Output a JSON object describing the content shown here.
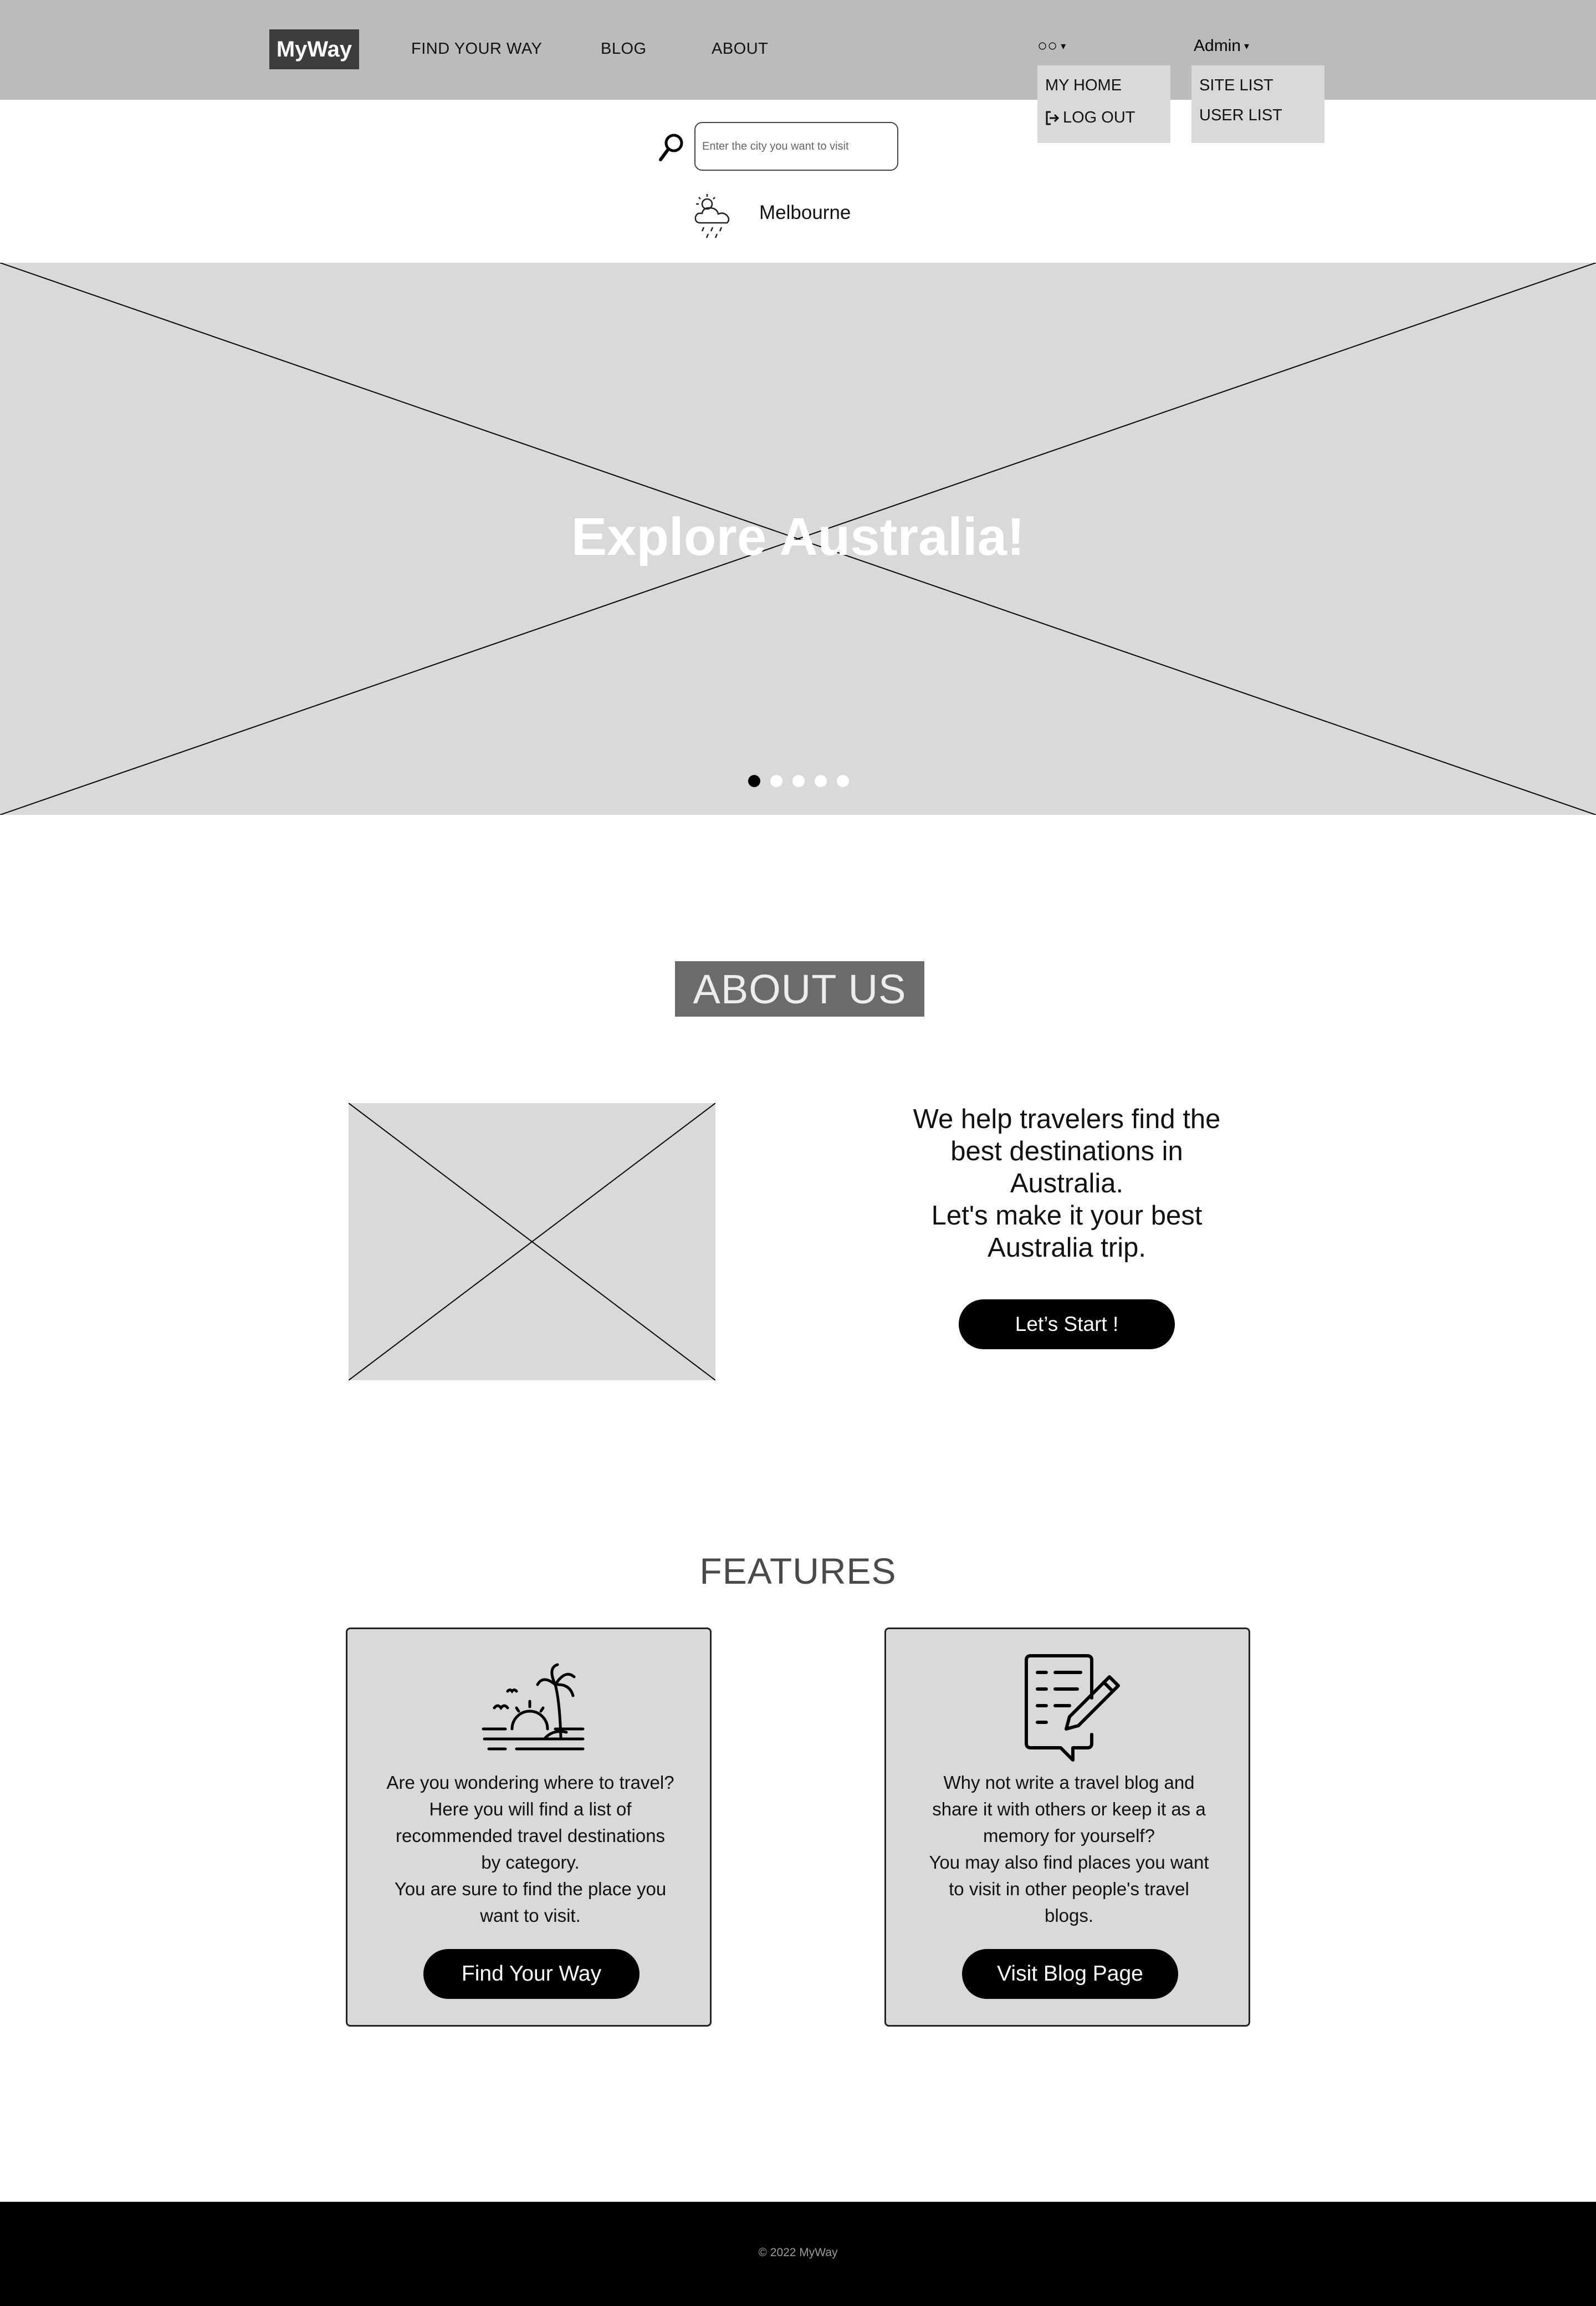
{
  "nav": {
    "logo": "MyWay",
    "links": [
      "FIND YOUR WAY",
      "BLOG",
      "ABOUT"
    ],
    "user_menu": {
      "label": "○○",
      "items": [
        "MY HOME",
        "LOG OUT"
      ]
    },
    "admin_menu": {
      "label": "Admin",
      "items": [
        "SITE LIST",
        "USER LIST"
      ]
    }
  },
  "search": {
    "placeholder": "Enter the city you want to visit",
    "icon": "search-icon"
  },
  "weather": {
    "icon": "sun-cloud-rain-icon",
    "city": "Melbourne"
  },
  "hero": {
    "title": "Explore Australia!",
    "slide_count": 5,
    "active_slide": 1
  },
  "about": {
    "title": "ABOUT US",
    "lines": [
      "We help travelers find the",
      "best destinations in",
      "Australia.",
      "Let's make it your best",
      "Australia trip."
    ],
    "button": "Let’s Start !"
  },
  "features": {
    "title": "FEATURES",
    "cards": [
      {
        "icon": "beach-palm-icon",
        "lines": [
          "Are you wondering where to travel?",
          "Here you will find a list of",
          "recommended travel destinations",
          "by category.",
          "You are sure to find the place you",
          "want to visit."
        ],
        "button": "Find Your Way"
      },
      {
        "icon": "blog-pen-icon",
        "lines": [
          "Why not write a travel blog and",
          "share it with others or keep it as a",
          "memory for yourself?",
          "You may also find places you want",
          "to visit in other people's travel",
          "blogs."
        ],
        "button": "Visit Blog Page"
      }
    ]
  },
  "footer": {
    "text": "© 2022 MyWay"
  },
  "colors": {
    "nav_bg": "#bbbbbb",
    "placeholder_gray": "#d9d9d9",
    "about_title_bg": "#6b6b6b",
    "button_bg": "#000000",
    "footer_bg": "#000000"
  }
}
